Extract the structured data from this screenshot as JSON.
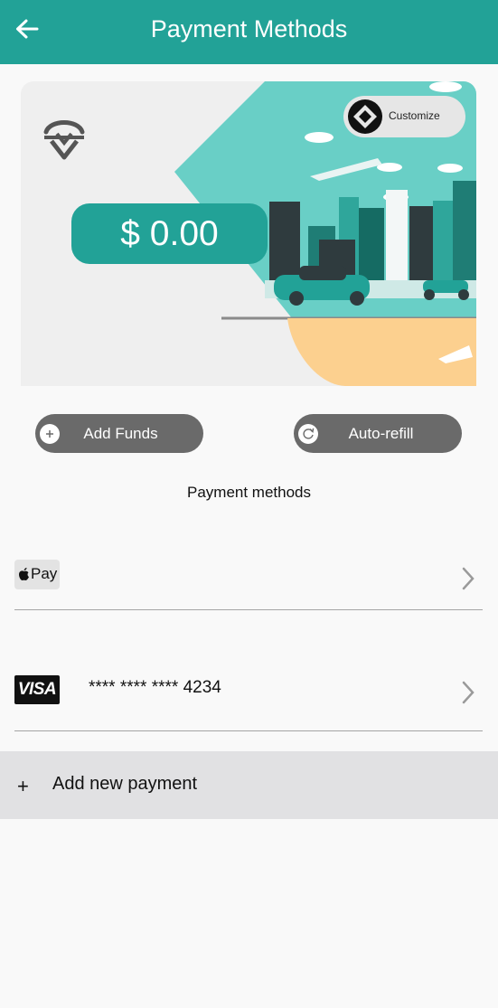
{
  "header": {
    "title": "Payment Methods",
    "back_icon": "arrow-left-icon"
  },
  "colors": {
    "brand": "#22a297",
    "pill": "#6a6a6a",
    "add_payment_bg": "#e1e1e3",
    "page_bg": "#f9f9f9"
  },
  "card": {
    "balance": "$ 0.00",
    "customize_label": "Customize",
    "logo_icon": "shield-logo-icon"
  },
  "actions": {
    "add_funds": {
      "label": "Add Funds",
      "icon": "plus-circle-icon"
    },
    "auto_refill": {
      "label": "Auto-refill",
      "icon": "refresh-icon"
    }
  },
  "payment_methods": {
    "section_label": "Payment methods",
    "items": [
      {
        "type": "apple-pay",
        "badge_text": "Pay",
        "badge_icon": "apple-logo-icon",
        "chevron_icon": "chevron-right-icon"
      },
      {
        "type": "visa",
        "badge_text": "VISA",
        "masked_number": "**** **** **** 4234",
        "chevron_icon": "chevron-right-icon"
      }
    ],
    "add_new": {
      "label": "Add new payment",
      "plus_symbol": "+"
    }
  }
}
